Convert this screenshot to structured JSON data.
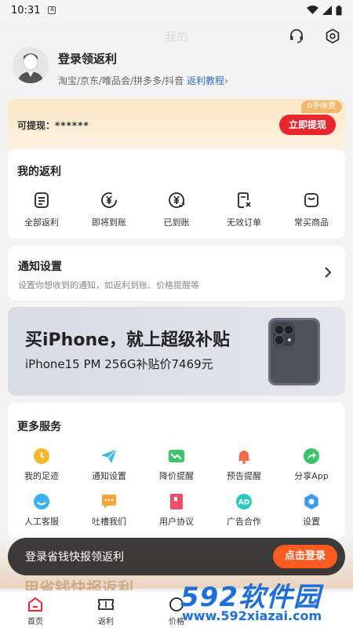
{
  "status_bar": {
    "time": "10:31",
    "notification_icon": "A"
  },
  "header": {
    "title": "我的",
    "support_icon": "headset-icon",
    "settings_icon": "settings-icon"
  },
  "profile": {
    "login_title": "登录领返利",
    "platforms": "淘宝/京东/唯品会/拼多多/抖音",
    "tutorial_link": "返利教程"
  },
  "cash": {
    "label": "可提现：",
    "value": "******",
    "fee_tag": "0手续费",
    "withdraw_label": "立即提现"
  },
  "rebate": {
    "title": "我的返利",
    "items": [
      {
        "label": "全部返利",
        "icon": "document-icon"
      },
      {
        "label": "即将到账",
        "icon": "yen-pending-icon"
      },
      {
        "label": "已到账",
        "icon": "yen-received-icon"
      },
      {
        "label": "无效订单",
        "icon": "invalid-order-icon"
      },
      {
        "label": "常买商品",
        "icon": "shopping-bag-icon"
      }
    ]
  },
  "notify": {
    "title": "通知设置",
    "subtitle": "设置你想收到的通知，如返利到账、价格提醒等"
  },
  "banner": {
    "title": "买iPhone，就上超级补贴",
    "subtitle": "iPhone15 PM 256G补贴价7469元"
  },
  "services": {
    "title": "更多服务",
    "row1": [
      {
        "label": "我的足迹",
        "icon": "clock-icon",
        "color": "#f5b82e"
      },
      {
        "label": "通知设置",
        "icon": "paper-plane-icon",
        "color": "#3bb8e8"
      },
      {
        "label": "降价提醒",
        "icon": "price-drop-icon",
        "color": "#3cc46a"
      },
      {
        "label": "预告提醒",
        "icon": "bell-icon",
        "color": "#f56b4a"
      },
      {
        "label": "分享App",
        "icon": "share-icon",
        "color": "#3cc46a"
      }
    ],
    "row2": [
      {
        "label": "人工客服",
        "icon": "customer-service-icon",
        "color": "#3bb0f0"
      },
      {
        "label": "吐槽我们",
        "icon": "chat-icon",
        "color": "#f5a53a"
      },
      {
        "label": "用户协议",
        "icon": "agreement-icon",
        "color": "#f04e6a"
      },
      {
        "label": "广告合作",
        "icon": "ad-icon",
        "color": "#2ec6c0"
      },
      {
        "label": "设置",
        "icon": "gear-icon",
        "color": "#3b9cf0"
      }
    ]
  },
  "promo": {
    "text": "登录省钱快报领返利",
    "button": "点击登录",
    "ghost": "用省钱快报返利"
  },
  "tabs": [
    {
      "label": "首页",
      "icon": "home-icon"
    },
    {
      "label": "返利",
      "icon": "ticket-icon"
    },
    {
      "label": "价格",
      "icon": "price-icon"
    }
  ],
  "watermark": {
    "brand": "592软件园",
    "url": "www.592xiazai.com"
  },
  "colors": {
    "accent_red": "#e8262d",
    "link_blue": "#2f6fd6",
    "promo_orange": "#ff5a1f"
  }
}
